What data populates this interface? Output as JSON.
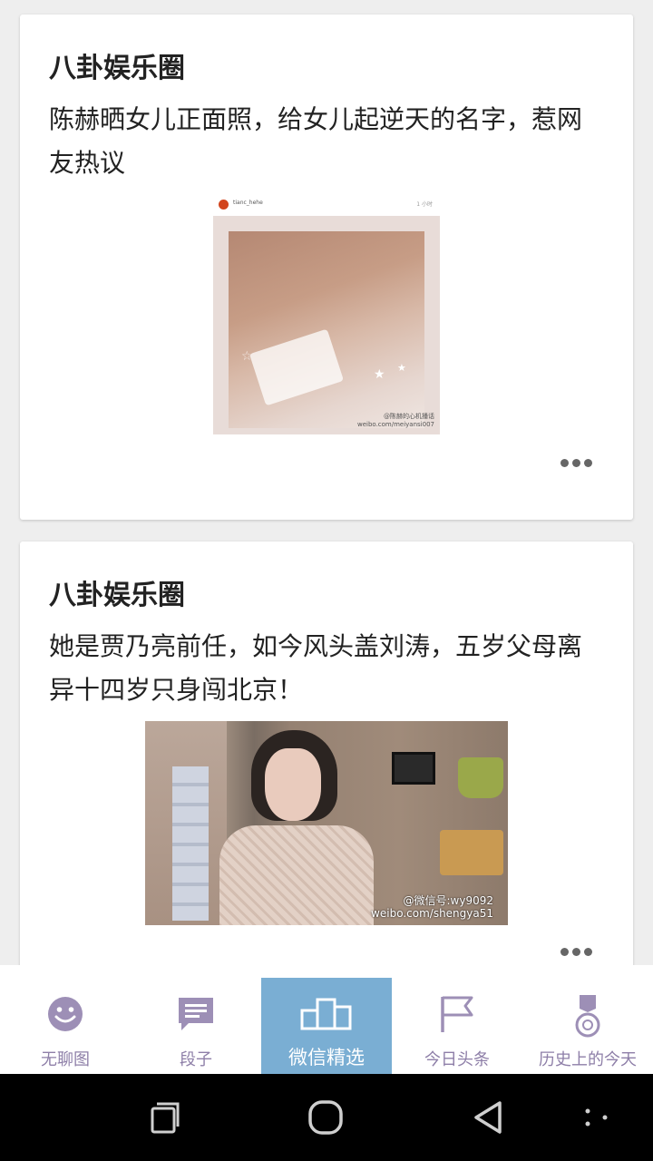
{
  "posts": [
    {
      "source": "八卦娱乐圈",
      "headline": "陈赫晒女儿正面照，给女儿起逆天的名字，惹网友热议",
      "image": {
        "ig_username": "tianc_hehe",
        "ig_time": "1 小时",
        "watermark_line1": "@陈赫的心机播话",
        "watermark_line2": "weibo.com/meiyansi007"
      }
    },
    {
      "source": "八卦娱乐圈",
      "headline": "她是贾乃亮前任，如今风头盖刘涛，五岁父母离异十四岁只身闯北京！",
      "image": {
        "watermark_line1": "@微信号:wy9092",
        "watermark_line2": "weibo.com/shengya51"
      }
    }
  ],
  "tabs": [
    {
      "label": "无聊图",
      "icon": "smiley-icon",
      "active": false
    },
    {
      "label": "段子",
      "icon": "chat-bubble-icon",
      "active": false
    },
    {
      "label": "微信精选",
      "icon": "podium-icon",
      "active": true
    },
    {
      "label": "今日头条",
      "icon": "flag-icon",
      "active": false
    },
    {
      "label": "历史上的今天",
      "icon": "medal-icon",
      "active": false
    }
  ],
  "colors": {
    "tab_active_bg": "#7aaed3",
    "tab_icon": "#9d8fb6",
    "tab_label": "#8e7fa8"
  },
  "system_nav": [
    "recent-apps-icon",
    "home-icon",
    "back-icon",
    "menu-icon"
  ]
}
